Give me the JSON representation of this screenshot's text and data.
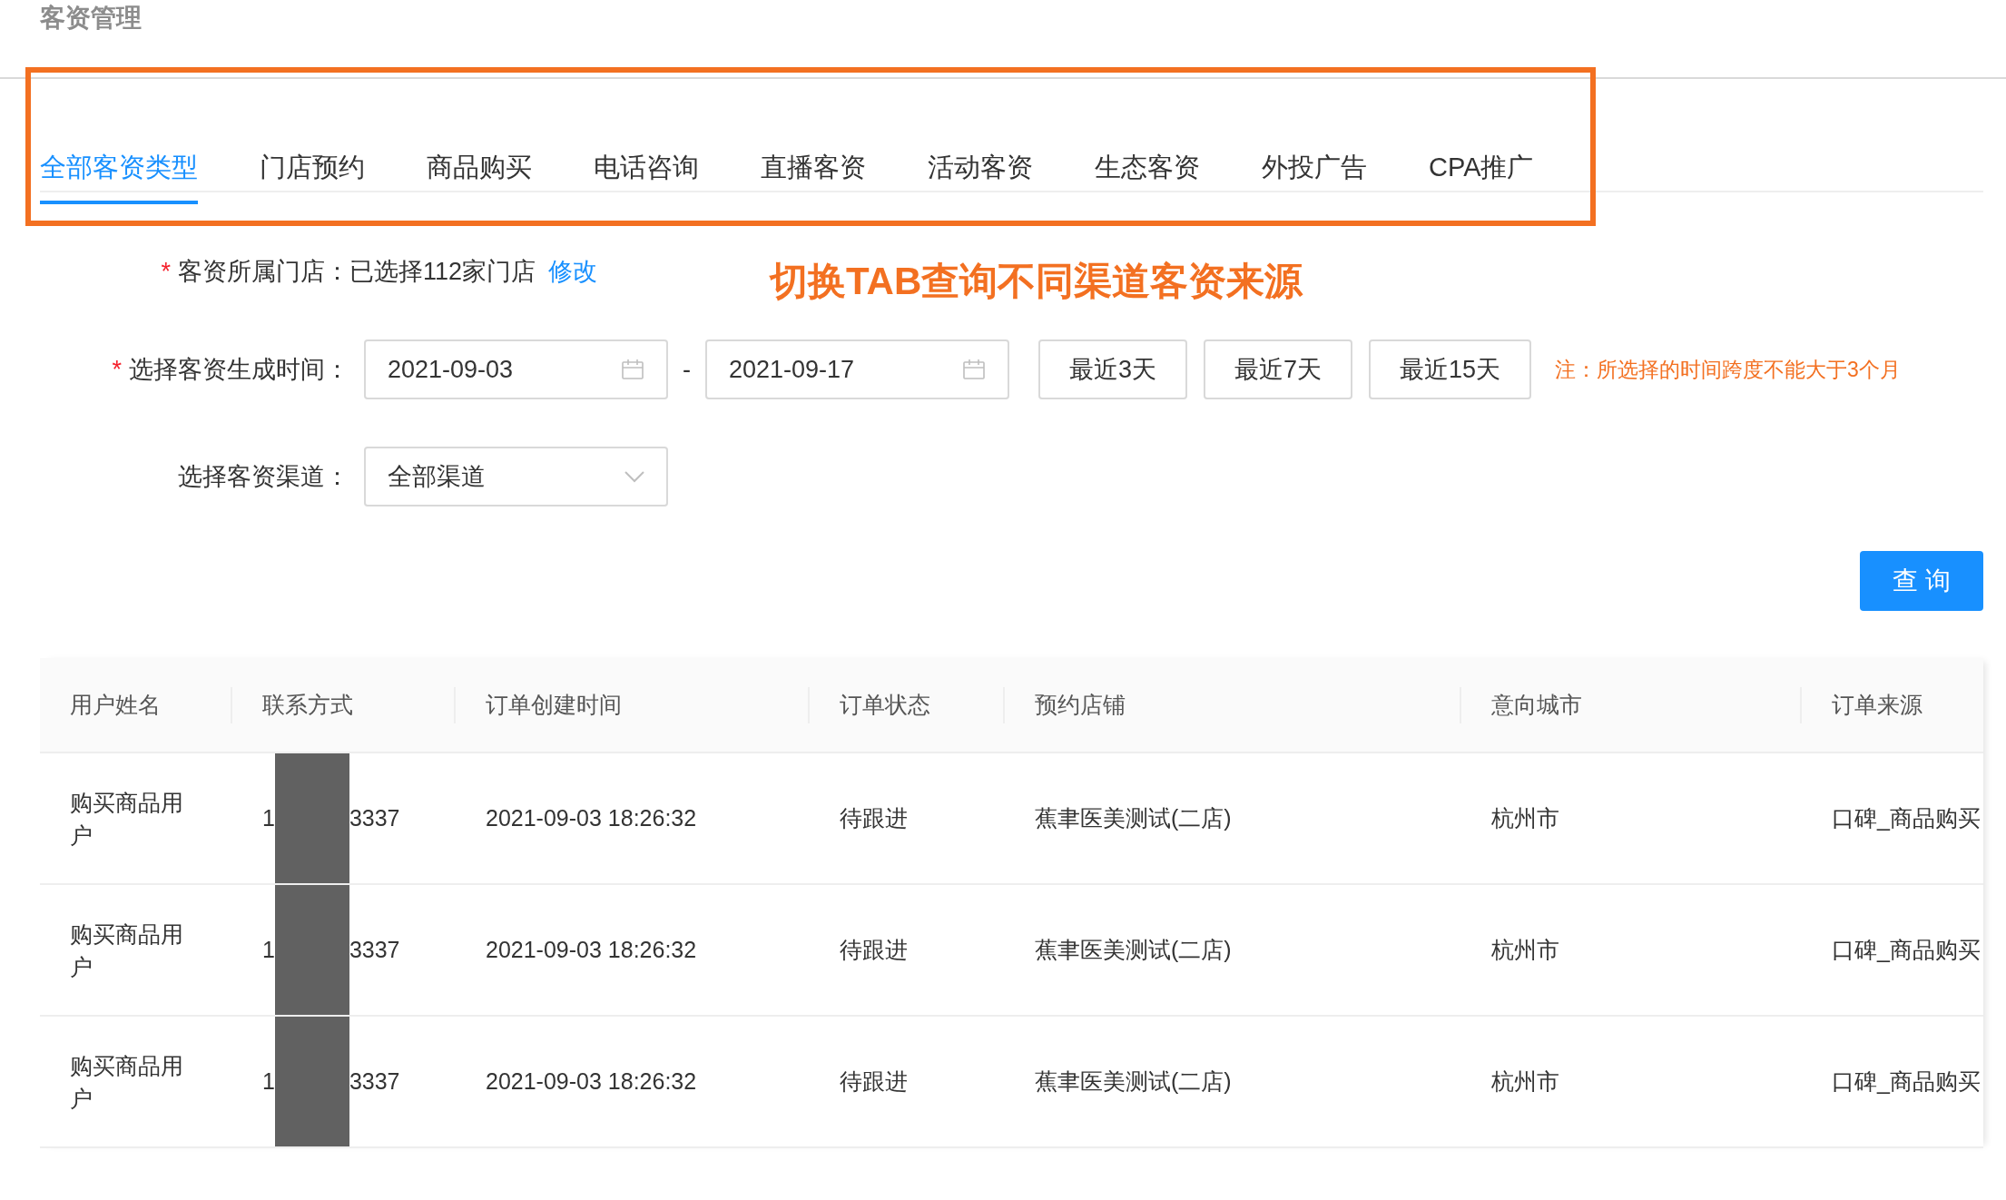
{
  "page_title": "客资管理",
  "tabs": [
    {
      "label": "全部客资类型",
      "selected": true
    },
    {
      "label": "门店预约",
      "selected": false
    },
    {
      "label": "商品购买",
      "selected": false
    },
    {
      "label": "电话咨询",
      "selected": false
    },
    {
      "label": "直播客资",
      "selected": false
    },
    {
      "label": "活动客资",
      "selected": false
    },
    {
      "label": "生态客资",
      "selected": false
    },
    {
      "label": "外投广告",
      "selected": false
    },
    {
      "label": "CPA推广",
      "selected": false
    }
  ],
  "annotation": "切换TAB查询不同渠道客资来源",
  "store_field": {
    "required_mark": "*",
    "label": "客资所属门店：",
    "value": "已选择112家门店",
    "link": "修改"
  },
  "time_field": {
    "required_mark": "*",
    "label": "选择客资生成时间：",
    "start": "2021-09-03",
    "separator": "-",
    "end": "2021-09-17",
    "quick_buttons": [
      "最近3天",
      "最近7天",
      "最近15天"
    ],
    "note": "注：所选择的时间跨度不能大于3个月"
  },
  "channel_field": {
    "label": "选择客资渠道：",
    "value": "全部渠道"
  },
  "query_button": "查 询",
  "table": {
    "columns": [
      "用户姓名",
      "联系方式",
      "订单创建时间",
      "订单状态",
      "预约店铺",
      "意向城市",
      "订单来源"
    ],
    "rows": [
      {
        "name": "购买商品用户",
        "contact_start": "1",
        "contact_end": "3337",
        "created": "2021-09-03 18:26:32",
        "status": "待跟进",
        "store": "蕉聿医美测试(二店)",
        "city": "杭州市",
        "source": "口碑_商品购买"
      },
      {
        "name": "购买商品用户",
        "contact_start": "1",
        "contact_end": "3337",
        "created": "2021-09-03 18:26:32",
        "status": "待跟进",
        "store": "蕉聿医美测试(二店)",
        "city": "杭州市",
        "source": "口碑_商品购买"
      },
      {
        "name": "购买商品用户",
        "contact_start": "1",
        "contact_end": "3337",
        "created": "2021-09-03 18:26:32",
        "status": "待跟进",
        "store": "蕉聿医美测试(二店)",
        "city": "杭州市",
        "source": "口碑_商品购买"
      }
    ]
  }
}
